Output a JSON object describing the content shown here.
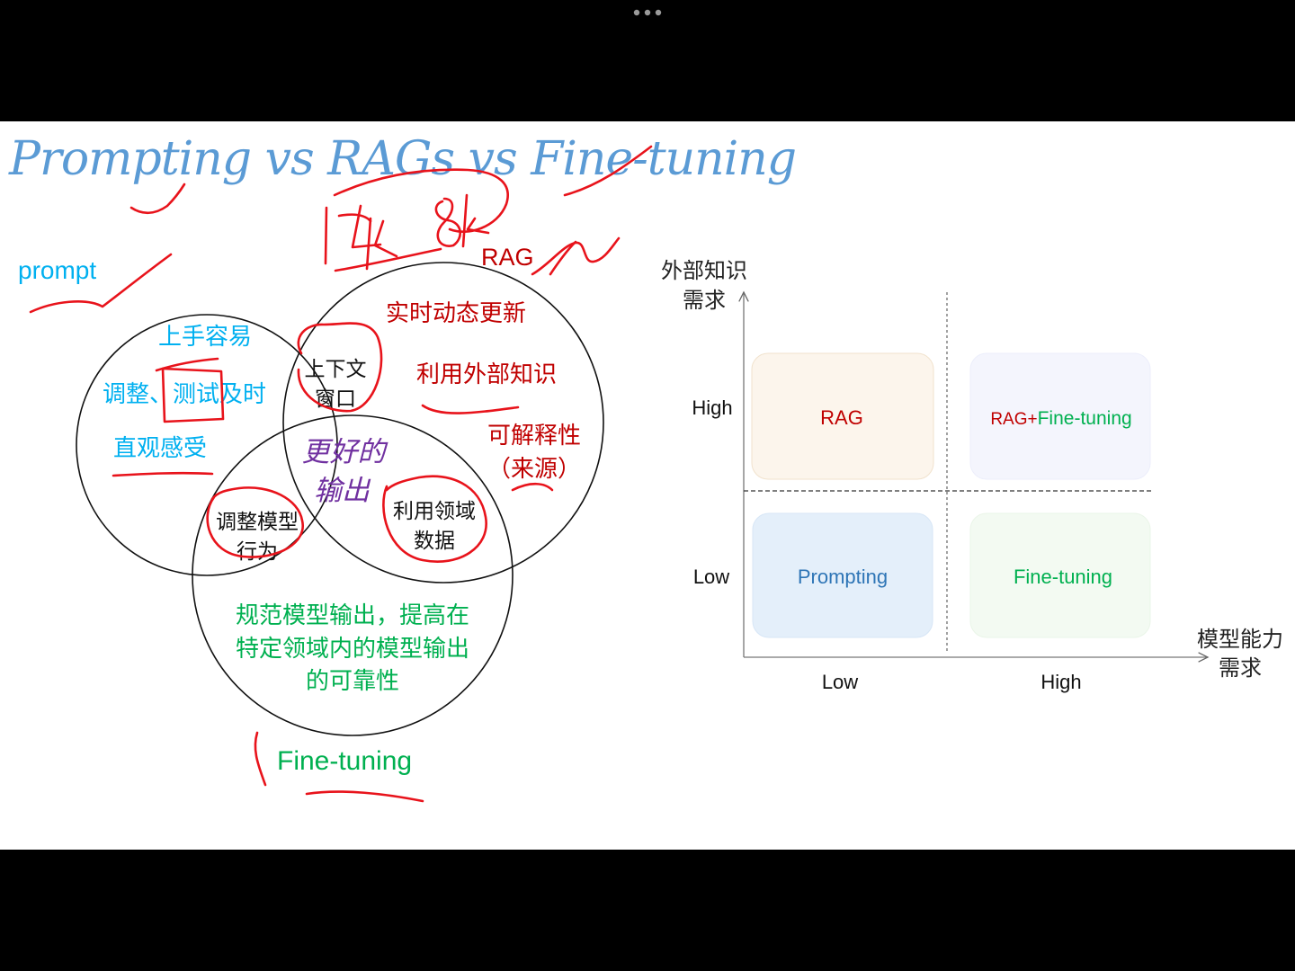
{
  "title": "Prompting vs RAGs vs Fine-tuning",
  "venn": {
    "prompt": {
      "label": "prompt",
      "items": [
        "上手容易",
        "调整、测试及时",
        "直观感受"
      ]
    },
    "rag": {
      "label": "RAG",
      "items": [
        "实时动态更新",
        "利用外部知识",
        "可解释性",
        "（来源）"
      ]
    },
    "finetuning": {
      "label": "Fine-tuning",
      "items": [
        "规范模型输出，提高在",
        "特定领域内的模型输出",
        "的可靠性"
      ]
    },
    "prompt_rag": [
      "上下文",
      "窗口"
    ],
    "prompt_ft": [
      "调整模型",
      "行为"
    ],
    "rag_ft": [
      "利用领域",
      "数据"
    ],
    "center": [
      "更好的",
      "输出"
    ]
  },
  "matrix": {
    "y_axis_label": [
      "外部知识",
      "需求"
    ],
    "x_axis_label": [
      "模型能力",
      "需求"
    ],
    "y_ticks": {
      "high": "High",
      "low": "Low"
    },
    "x_ticks": {
      "low": "Low",
      "high": "High"
    },
    "quadrants": {
      "high_low": {
        "label": "RAG",
        "color": "#c00000"
      },
      "high_high": {
        "prefix": "RAG+",
        "suffix": "Fine-tuning",
        "prefix_color": "#c00000",
        "suffix_color": "#00b050"
      },
      "low_low": {
        "label": "Prompting",
        "color": "#2e75b6"
      },
      "low_high": {
        "label": "Fine-tuning",
        "color": "#00b050"
      }
    }
  },
  "annotations": {
    "handwritten": [
      "14K",
      "8K"
    ]
  },
  "colors": {
    "title": "#5b9bd5",
    "prompt": "#00b0f0",
    "rag": "#c00000",
    "finetuning": "#00b050",
    "center": "#7030a0",
    "ink": "#e8131b"
  }
}
